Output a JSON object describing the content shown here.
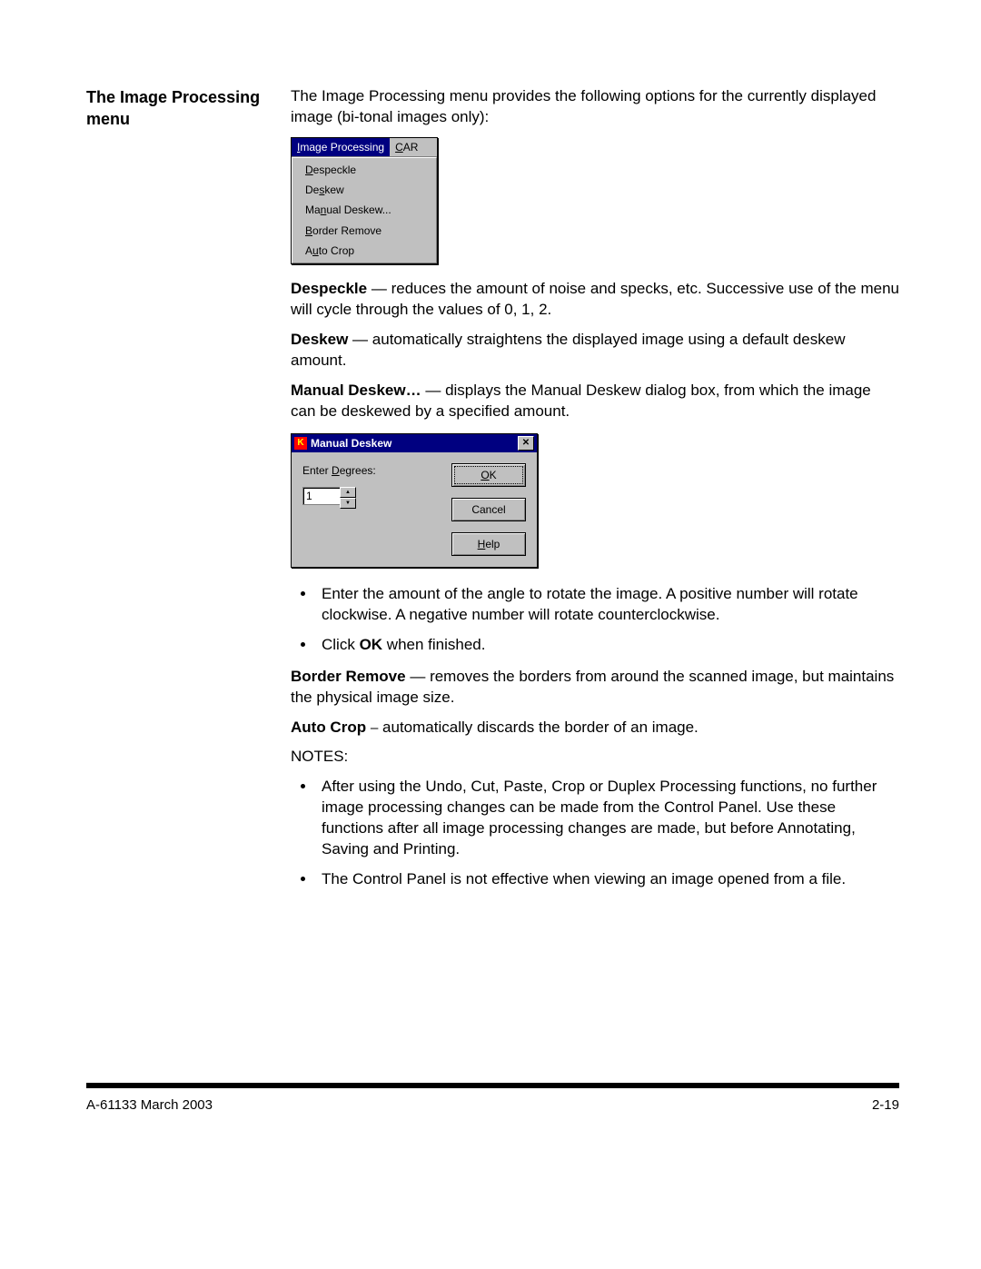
{
  "heading": "The Image Processing menu",
  "intro": "The Image Processing menu provides the following options for the currently displayed image (bi-tonal images only):",
  "menu_shot": {
    "bar": {
      "active": "Image Processing",
      "next": "CAR"
    },
    "items": [
      "Despeckle",
      "Deskew",
      "Manual Deskew...",
      "Border Remove",
      "Auto Crop"
    ],
    "underlines": [
      "I",
      "C",
      "D",
      "s",
      "n",
      "B",
      "u"
    ]
  },
  "despeckle": {
    "label": "Despeckle",
    "dash": " — ",
    "text": "reduces the amount of noise and specks, etc. Successive use of the menu will cycle through the values of 0, 1, 2."
  },
  "deskew": {
    "label": "Deskew",
    "dash": " — ",
    "text": "automatically straightens the displayed image using a default deskew amount."
  },
  "manual_deskew": {
    "label": "Manual Deskew…",
    "dash": " — ",
    "text": "displays the Manual Deskew dialog box, from which the image can be deskewed by a specified amount."
  },
  "dialog": {
    "title": "Manual Deskew",
    "field_label": "Enter Degrees:",
    "value": "1",
    "ok": "OK",
    "cancel": "Cancel",
    "help": "Help"
  },
  "bullets1": [
    "Enter the amount of the angle to rotate the image.  A positive number will rotate clockwise. A negative number will rotate counterclockwise."
  ],
  "bullet_click_pre": "Click ",
  "bullet_click_bold": "OK",
  "bullet_click_post": " when finished.",
  "border_remove": {
    "label": "Border Remove",
    "dash": " — ",
    "text": "removes the borders from around the scanned image, but maintains the physical image size."
  },
  "auto_crop": {
    "label": "Auto Crop",
    "dash": " — ",
    "text": "automatically discards the border of an image.",
    "long_dash": " ⎯ "
  },
  "notes_label": "NOTES:",
  "notes": [
    "After using the Undo, Cut, Paste, Crop or Duplex Processing functions, no further image processing changes can be made from the Control Panel. Use these functions after all image processing changes are made, but before Annotating, Saving and Printing.",
    "The Control Panel is not effective when viewing an image opened from a file."
  ],
  "footer": {
    "left": "A-61133  March 2003",
    "right": "2-19"
  }
}
